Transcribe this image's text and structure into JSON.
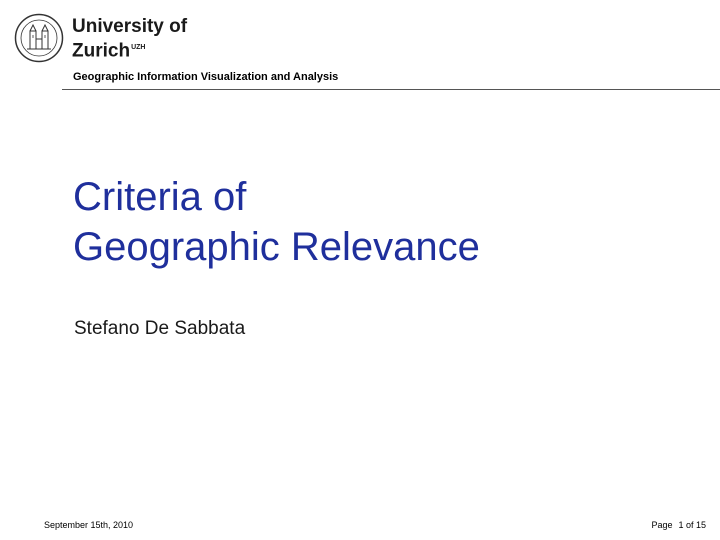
{
  "header": {
    "university_line1": "University of",
    "university_line2": "Zurich",
    "university_suffix": "UZH",
    "course": "Geographic Information Visualization and Analysis",
    "seal_icon": "university-seal-icon"
  },
  "title": {
    "line1": "Criteria of",
    "line2": "Geographic Relevance"
  },
  "author": "Stefano De Sabbata",
  "footer": {
    "date": "September 15th, 2010",
    "page_label": "Page",
    "page_value": "1 of 15"
  },
  "colors": {
    "title": "#1f2f9c",
    "text": "#1a1a1a"
  }
}
